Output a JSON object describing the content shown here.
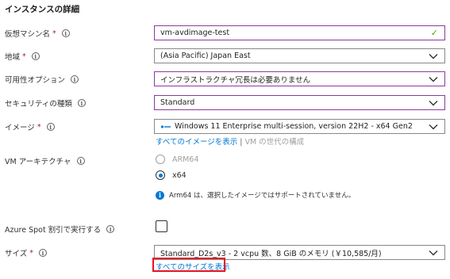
{
  "section_title": "インスタンスの詳細",
  "fields": {
    "vm_name": {
      "label": "仮想マシン名",
      "value": "vm-avdimage-test"
    },
    "region": {
      "label": "地域",
      "value": "(Asia Pacific) Japan East"
    },
    "availability": {
      "label": "可用性オプション",
      "value": "インフラストラクチャ冗長は必要ありません"
    },
    "security": {
      "label": "セキュリティの種類",
      "value": "Standard"
    },
    "image": {
      "label": "イメージ",
      "value": "Windows 11 Enterprise multi-session, version 22H2 - x64 Gen2",
      "link_all": "すべてのイメージを表示",
      "separator": "|",
      "link_gen": "VM の世代の構成"
    },
    "arch": {
      "label": "VM アーキテクチャ",
      "options": [
        "ARM64",
        "x64"
      ],
      "note": "Arm64 は、選択したイメージではサポートされていません。"
    },
    "spot": {
      "label": "Azure Spot 割引で実行する"
    },
    "size": {
      "label": "サイズ",
      "value": "Standard_D2s_v3 - 2 vcpu 数、8 GiB のメモリ (￥10,585/月)",
      "link_all": "すべてのサイズを表示"
    }
  },
  "required_mark": "*",
  "colors": {
    "accent": "#0078d4",
    "focus_border": "#8a3b9e",
    "highlight": "#e81123",
    "valid_check": "#57a300"
  }
}
